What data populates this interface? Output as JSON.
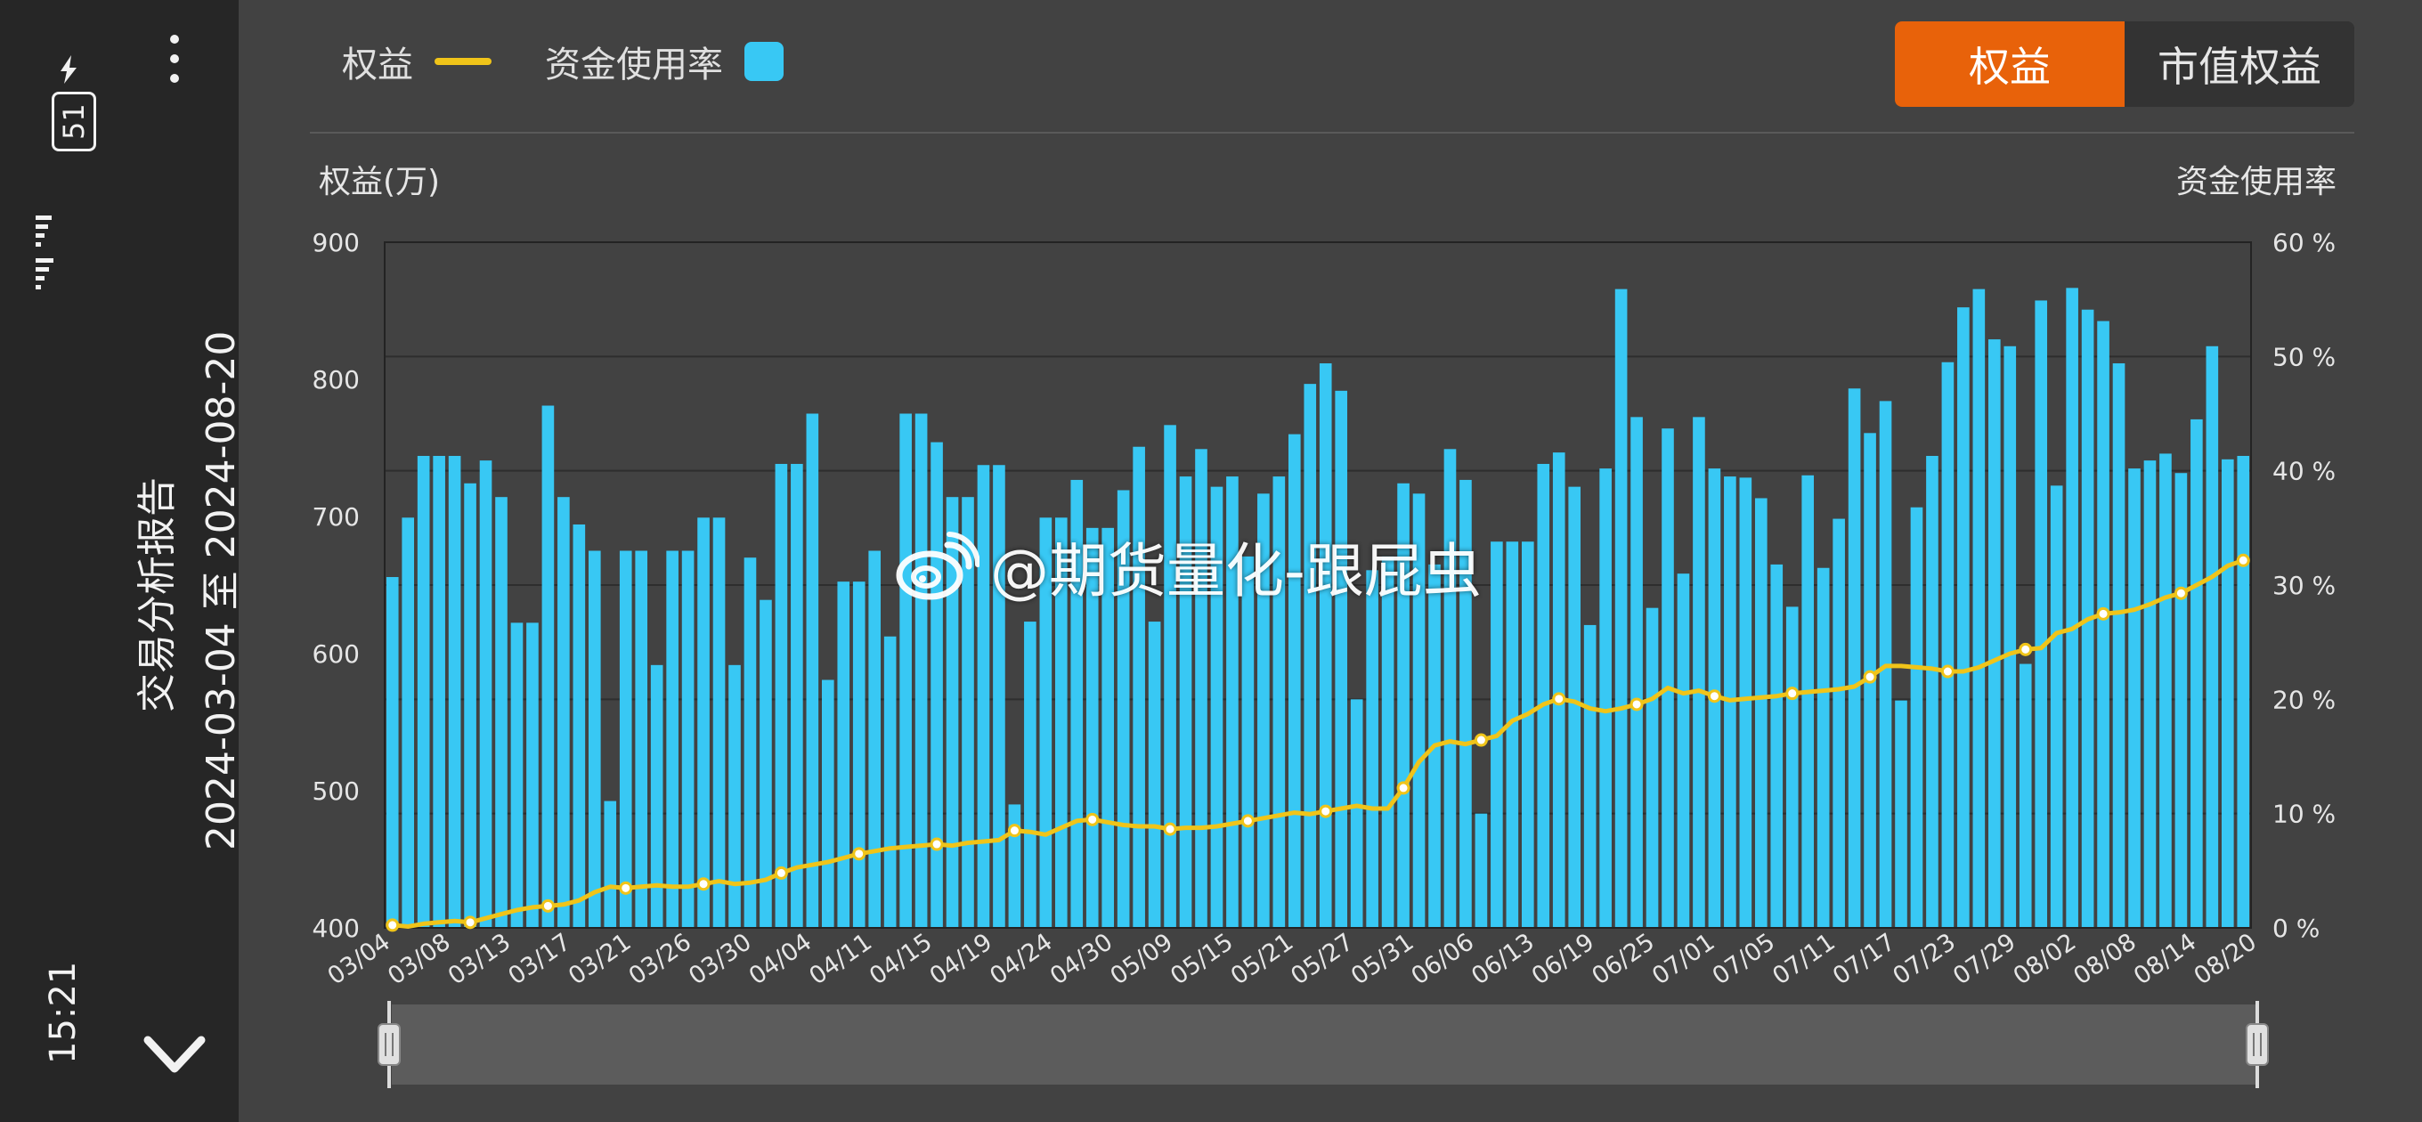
{
  "sidebar": {
    "title": "交易分析报告",
    "range": "2024-03-04 至 2024-08-20",
    "clock": "15:21",
    "battery": "51"
  },
  "legend": {
    "equity": "权益",
    "usage": "资金使用率"
  },
  "toggle": {
    "equity": "权益",
    "market_value": "市值权益"
  },
  "watermark": "@期货量化-跟屁虫",
  "colors": {
    "bar": "#38c8f4",
    "line": "#f0c419",
    "accent": "#e8620a",
    "background": "#424242",
    "sidebar": "#262626"
  },
  "chart_data": {
    "type": "bar",
    "ylabel": "权益(万)",
    "y2label": "资金使用率",
    "yticks": [
      "900",
      "800",
      "700",
      "600",
      "500",
      "400"
    ],
    "y2ticks": [
      "60 %",
      "50 %",
      "40 %",
      "30 %",
      "20 %",
      "10 %",
      "0 %"
    ],
    "ylim": [
      400,
      900
    ],
    "y2lim": [
      0,
      60
    ],
    "grid": true,
    "legend_position": "top-left",
    "xticks": [
      "03/04",
      "03/08",
      "03/13",
      "03/17",
      "03/21",
      "03/26",
      "03/30",
      "04/04",
      "04/11",
      "04/15",
      "04/19",
      "04/24",
      "04/30",
      "05/09",
      "05/15",
      "05/21",
      "05/27",
      "05/31",
      "06/06",
      "06/13",
      "06/19",
      "06/25",
      "07/01",
      "07/05",
      "07/11",
      "07/17",
      "07/23",
      "07/29",
      "08/02",
      "08/08",
      "08/14",
      "08/20"
    ],
    "series": [
      {
        "name": "资金使用率",
        "type": "bar",
        "axis": "right",
        "values": [
          30.7,
          35.9,
          41.3,
          41.3,
          41.3,
          38.9,
          40.9,
          37.7,
          26.7,
          26.7,
          45.7,
          37.7,
          35.3,
          33.0,
          11.1,
          33.0,
          33.0,
          23.0,
          33.0,
          33.0,
          35.9,
          35.9,
          23.0,
          32.4,
          28.7,
          40.6,
          40.6,
          45.0,
          21.7,
          30.3,
          30.3,
          33.0,
          25.5,
          45.0,
          45.0,
          42.5,
          37.7,
          37.7,
          40.5,
          40.5,
          10.8,
          26.8,
          35.9,
          35.9,
          39.2,
          35.0,
          35.0,
          38.3,
          42.1,
          26.8,
          44.0,
          39.5,
          41.9,
          38.6,
          39.5,
          32.5,
          38.0,
          39.5,
          43.2,
          47.6,
          49.4,
          47.0,
          20.0,
          31.3,
          32.5,
          38.9,
          38.0,
          31.8,
          41.9,
          39.2,
          10.0,
          33.8,
          33.8,
          33.8,
          40.6,
          41.6,
          38.6,
          26.5,
          40.2,
          55.9,
          44.7,
          28.0,
          43.7,
          31.0,
          44.7,
          40.2,
          39.5,
          39.4,
          37.6,
          31.8,
          28.1,
          39.6,
          31.5,
          35.8,
          47.2,
          43.3,
          46.1,
          19.9,
          36.8,
          41.3,
          49.5,
          54.3,
          55.9,
          51.5,
          50.9,
          23.1,
          54.9,
          38.7,
          56.0,
          54.1,
          53.1,
          49.4,
          40.2,
          40.9,
          41.5,
          39.8,
          44.5,
          50.9,
          41.0,
          41.3
        ]
      },
      {
        "name": "权益",
        "type": "line",
        "axis": "left",
        "values": [
          402,
          401,
          403,
          404,
          405,
          404,
          407,
          410,
          413,
          415,
          416,
          417,
          420,
          426,
          430,
          429,
          430,
          431,
          430,
          430,
          432,
          434,
          432,
          433,
          435,
          440,
          444,
          446,
          448,
          451,
          454,
          456,
          458,
          459,
          460,
          461,
          460,
          462,
          463,
          464,
          471,
          470,
          468,
          473,
          478,
          479,
          477,
          475,
          474,
          474,
          472,
          473,
          473,
          474,
          476,
          478,
          480,
          482,
          484,
          483,
          485,
          487,
          489,
          487,
          487,
          502,
          521,
          533,
          536,
          534,
          537,
          540,
          551,
          556,
          563,
          567,
          565,
          560,
          558,
          560,
          563,
          567,
          575,
          571,
          573,
          569,
          566,
          567,
          568,
          569,
          571,
          572,
          573,
          574,
          576,
          583,
          591,
          591,
          590,
          589,
          587,
          587,
          590,
          595,
          600,
          603,
          604,
          615,
          618,
          625,
          629,
          630,
          632,
          636,
          641,
          644,
          650,
          656,
          664,
          668
        ]
      }
    ],
    "markers": [
      0,
      5,
      10,
      15,
      20,
      25,
      30,
      35,
      40,
      45,
      50,
      55,
      60,
      65,
      70,
      75,
      80,
      85,
      90,
      95,
      100,
      105,
      110,
      115,
      119
    ]
  }
}
